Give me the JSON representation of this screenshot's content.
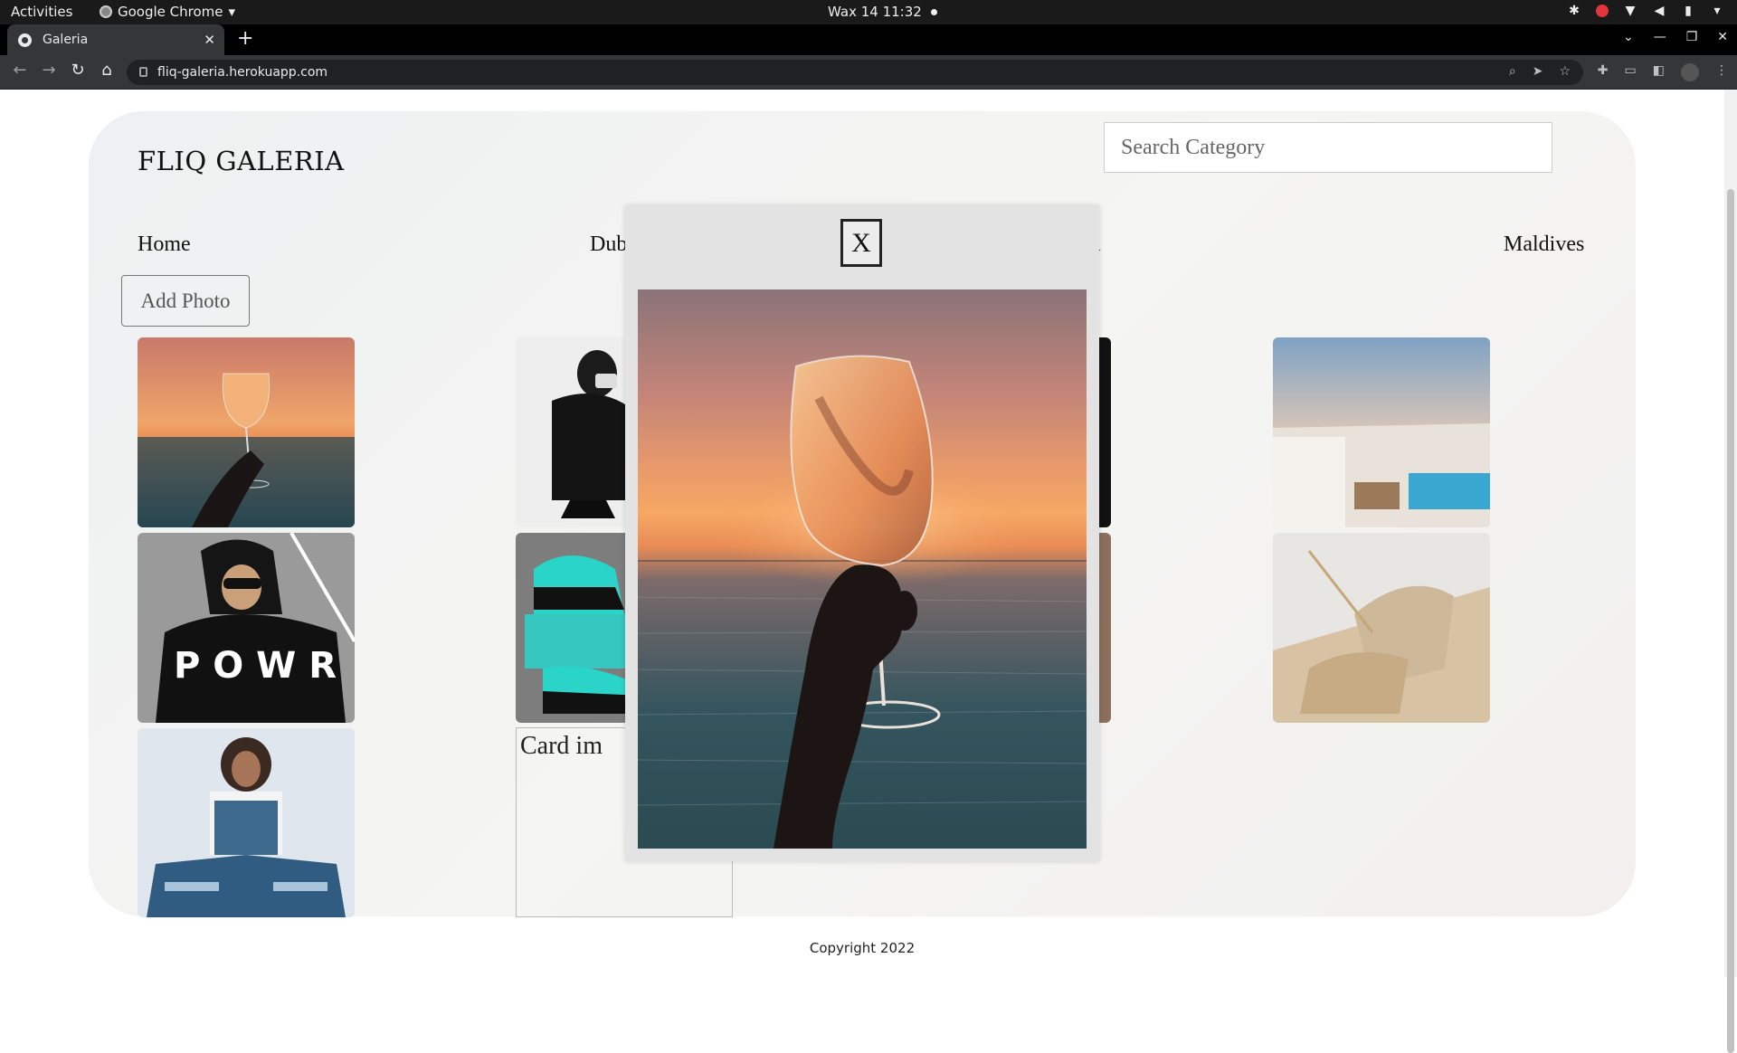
{
  "topbar": {
    "activities": "Activities",
    "app_name": "Google Chrome",
    "clock": "Wax 14  11:32"
  },
  "browser": {
    "tab_title": "Galeria",
    "new_tab": "+",
    "url": "fliq-galeria.herokuapp.com"
  },
  "header": {
    "brand": "FLIQ GALERIA",
    "search_placeholder": "Search Category"
  },
  "nav": {
    "home": "Home",
    "dubai_partial": "Dub",
    "hidden_partial": "a",
    "maldives": "Maldives"
  },
  "actions": {
    "add_photo": "Add Photo"
  },
  "gallery": {
    "broken_alt": "Card im",
    "thumbnails": [
      {
        "subject": "wine glass at sunset"
      },
      {
        "subject": "hooded sweatshirt POWR"
      },
      {
        "subject": "denim outfit"
      },
      {
        "subject": "black hoodie mirror selfie"
      },
      {
        "subject": "teal sneakers with box"
      },
      {
        "subject": "resort pool at dusk"
      },
      {
        "subject": "beige sneakers"
      }
    ]
  },
  "modal": {
    "close_label": "X",
    "image_subject": "wine glass at sunset over sea"
  },
  "footer": {
    "copyright": "Copyright 2022"
  },
  "colors": {
    "page_bg": "#f1f1ef",
    "modal_bg": "#e3e3e3",
    "chrome_dark": "#35363a"
  }
}
